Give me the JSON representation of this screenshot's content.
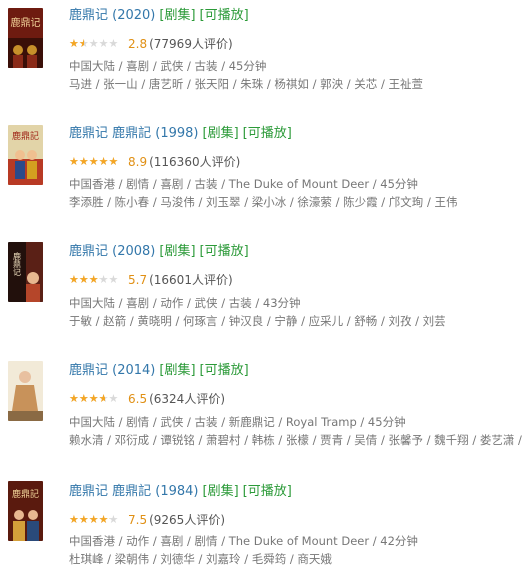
{
  "results": [
    {
      "title": "鹿鼎记 (2020)",
      "tag_series": "[剧集]",
      "tag_playable": "[可播放]",
      "rating": 2.8,
      "score": "2.8",
      "votes": "(77969人评价)",
      "meta": "中国大陆 / 喜剧 / 武侠 / 古装 / 45分钟",
      "cast": "马进 / 张一山 / 唐艺昕 / 张天阳 / 朱珠 / 杨祺如 / 郭泱 / 关芯 / 王祉萱",
      "poster_text": "鹿鼎记",
      "poster_colors": [
        "#7a1f12",
        "#c8902a"
      ]
    },
    {
      "title": "鹿鼎记 鹿鼎記 (1998)",
      "tag_series": "[剧集]",
      "tag_playable": "[可播放]",
      "rating": 8.9,
      "score": "8.9",
      "votes": "(116360人评价)",
      "meta": "中国香港 / 剧情 / 喜剧 / 古装 / The Duke of Mount Deer / 45分钟",
      "cast": "李添胜 / 陈小春 / 马浚伟 / 刘玉翠 / 梁小冰 / 徐濠萦 / 陈少霞 / 邝文珣 / 王伟",
      "poster_text": "鹿鼎記",
      "poster_colors": [
        "#d8c89a",
        "#c0392b"
      ]
    },
    {
      "title": "鹿鼎记 (2008)",
      "tag_series": "[剧集]",
      "tag_playable": "[可播放]",
      "rating": 5.7,
      "score": "5.7",
      "votes": "(16601人评价)",
      "meta": "中国大陆 / 喜剧 / 动作 / 武侠 / 古装 / 43分钟",
      "cast": "于敏 / 赵箭 / 黄晓明 / 何琢言 / 钟汉良 / 宁静 / 应采儿 / 舒畅 / 刘孜 / 刘芸",
      "poster_text": "鹿鼎记",
      "poster_colors": [
        "#2a1410",
        "#b5462a"
      ]
    },
    {
      "title": "鹿鼎记 (2014)",
      "tag_series": "[剧集]",
      "tag_playable": "[可播放]",
      "rating": 6.5,
      "score": "6.5",
      "votes": "(6324人评价)",
      "meta": "中国大陆 / 剧情 / 武侠 / 古装 / 新鹿鼎记 / Royal Tramp / 45分钟",
      "cast": "赖水清 / 邓衍成 / 谭锐铭 / 萧碧村 / 韩栋 / 张檬 / 贾青 / 吴倩 / 张馨予 / 魏千翔 / 娄艺潇 /",
      "poster_text": "",
      "poster_colors": [
        "#e8dcc4",
        "#b8885a"
      ]
    },
    {
      "title": "鹿鼎记 鹿鼎記 (1984)",
      "tag_series": "[剧集]",
      "tag_playable": "[可播放]",
      "rating": 7.5,
      "score": "7.5",
      "votes": "(9265人评价)",
      "meta": "中国香港 / 动作 / 喜剧 / 剧情 / The Duke of Mount Deer / 42分钟",
      "cast": "杜琪峰 / 梁朝伟 / 刘德华 / 刘嘉玲 / 毛舜筠 / 商天娥",
      "poster_text": "鹿鼎記",
      "poster_colors": [
        "#5a1a0e",
        "#d4a03a"
      ]
    }
  ]
}
